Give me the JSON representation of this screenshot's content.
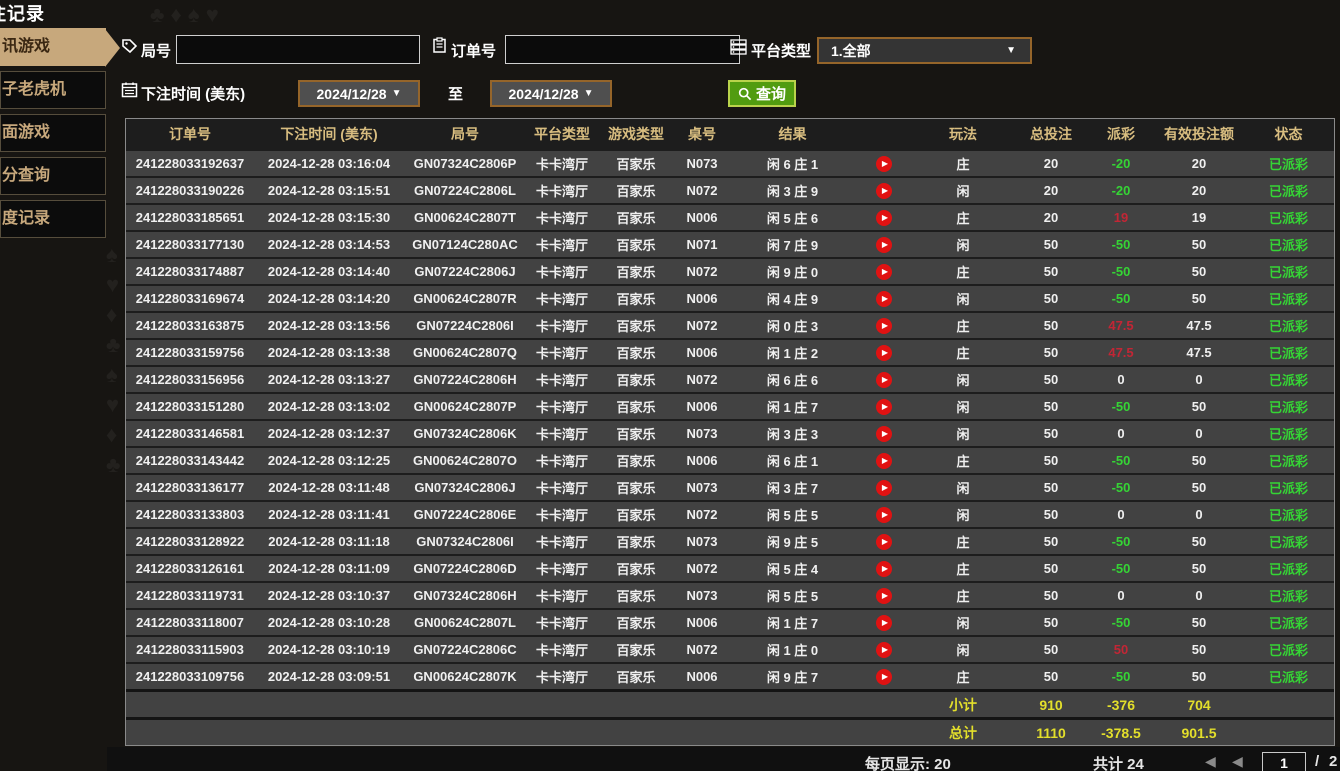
{
  "colors": {
    "page_bg": "#171512",
    "tan": "#c7a87c",
    "gold": "#d8bd80",
    "green": "#35d435",
    "red": "#e01212",
    "red_txt": "#c22635",
    "yellow": "#e3df2b",
    "btn_green": "#519c10",
    "sel_border": "#95652a",
    "row_bg": "#424242"
  },
  "title": "注记录",
  "sidebar": {
    "items": [
      {
        "label": "讯游戏",
        "selected": true
      },
      {
        "label": "子老虎机",
        "selected": false
      },
      {
        "label": "面游戏",
        "selected": false
      },
      {
        "label": "分查询",
        "selected": false
      },
      {
        "label": "度记录",
        "selected": false
      }
    ]
  },
  "filters": {
    "round_label": "局号",
    "round_value": "",
    "order_label": "订单号",
    "order_value": "",
    "platform_label": "平台类型",
    "platform_value": "1.全部",
    "bettime_label": "下注时间 (美东)",
    "date_from": "2024/12/28",
    "to_label": "至",
    "date_to": "2024/12/28",
    "search_label": "查询",
    "caret": "▼"
  },
  "table": {
    "headers": [
      "订单号",
      "下注时间 (美东)",
      "局号",
      "平台类型",
      "游戏类型",
      "桌号",
      "结果",
      "玩法",
      "总投注",
      "派彩",
      "有效投注额",
      "状态"
    ],
    "rows": [
      {
        "order_id": "241228033192637",
        "bet_time": "2024-12-28 03:16:04",
        "round_id": "GN07324C2806P",
        "platform": "卡卡湾厅",
        "game_type": "百家乐",
        "table_no": "N073",
        "result": "闲 6 庄 1",
        "bet_on": "庄",
        "total_bet": "20",
        "payout": "-20",
        "valid_bet": "20",
        "status": "已派彩"
      },
      {
        "order_id": "241228033190226",
        "bet_time": "2024-12-28 03:15:51",
        "round_id": "GN07224C2806L",
        "platform": "卡卡湾厅",
        "game_type": "百家乐",
        "table_no": "N072",
        "result": "闲 3 庄 9",
        "bet_on": "闲",
        "total_bet": "20",
        "payout": "-20",
        "valid_bet": "20",
        "status": "已派彩"
      },
      {
        "order_id": "241228033185651",
        "bet_time": "2024-12-28 03:15:30",
        "round_id": "GN00624C2807T",
        "platform": "卡卡湾厅",
        "game_type": "百家乐",
        "table_no": "N006",
        "result": "闲 5 庄 6",
        "bet_on": "庄",
        "total_bet": "20",
        "payout": "19",
        "valid_bet": "19",
        "status": "已派彩"
      },
      {
        "order_id": "241228033177130",
        "bet_time": "2024-12-28 03:14:53",
        "round_id": "GN07124C280AC",
        "platform": "卡卡湾厅",
        "game_type": "百家乐",
        "table_no": "N071",
        "result": "闲 7 庄 9",
        "bet_on": "闲",
        "total_bet": "50",
        "payout": "-50",
        "valid_bet": "50",
        "status": "已派彩"
      },
      {
        "order_id": "241228033174887",
        "bet_time": "2024-12-28 03:14:40",
        "round_id": "GN07224C2806J",
        "platform": "卡卡湾厅",
        "game_type": "百家乐",
        "table_no": "N072",
        "result": "闲 9 庄 0",
        "bet_on": "庄",
        "total_bet": "50",
        "payout": "-50",
        "valid_bet": "50",
        "status": "已派彩"
      },
      {
        "order_id": "241228033169674",
        "bet_time": "2024-12-28 03:14:20",
        "round_id": "GN00624C2807R",
        "platform": "卡卡湾厅",
        "game_type": "百家乐",
        "table_no": "N006",
        "result": "闲 4 庄 9",
        "bet_on": "闲",
        "total_bet": "50",
        "payout": "-50",
        "valid_bet": "50",
        "status": "已派彩"
      },
      {
        "order_id": "241228033163875",
        "bet_time": "2024-12-28 03:13:56",
        "round_id": "GN07224C2806I",
        "platform": "卡卡湾厅",
        "game_type": "百家乐",
        "table_no": "N072",
        "result": "闲 0 庄 3",
        "bet_on": "庄",
        "total_bet": "50",
        "payout": "47.5",
        "valid_bet": "47.5",
        "status": "已派彩"
      },
      {
        "order_id": "241228033159756",
        "bet_time": "2024-12-28 03:13:38",
        "round_id": "GN00624C2807Q",
        "platform": "卡卡湾厅",
        "game_type": "百家乐",
        "table_no": "N006",
        "result": "闲 1 庄 2",
        "bet_on": "庄",
        "total_bet": "50",
        "payout": "47.5",
        "valid_bet": "47.5",
        "status": "已派彩"
      },
      {
        "order_id": "241228033156956",
        "bet_time": "2024-12-28 03:13:27",
        "round_id": "GN07224C2806H",
        "platform": "卡卡湾厅",
        "game_type": "百家乐",
        "table_no": "N072",
        "result": "闲 6 庄 6",
        "bet_on": "闲",
        "total_bet": "50",
        "payout": "0",
        "valid_bet": "0",
        "status": "已派彩"
      },
      {
        "order_id": "241228033151280",
        "bet_time": "2024-12-28 03:13:02",
        "round_id": "GN00624C2807P",
        "platform": "卡卡湾厅",
        "game_type": "百家乐",
        "table_no": "N006",
        "result": "闲 1 庄 7",
        "bet_on": "闲",
        "total_bet": "50",
        "payout": "-50",
        "valid_bet": "50",
        "status": "已派彩"
      },
      {
        "order_id": "241228033146581",
        "bet_time": "2024-12-28 03:12:37",
        "round_id": "GN07324C2806K",
        "platform": "卡卡湾厅",
        "game_type": "百家乐",
        "table_no": "N073",
        "result": "闲 3 庄 3",
        "bet_on": "闲",
        "total_bet": "50",
        "payout": "0",
        "valid_bet": "0",
        "status": "已派彩"
      },
      {
        "order_id": "241228033143442",
        "bet_time": "2024-12-28 03:12:25",
        "round_id": "GN00624C2807O",
        "platform": "卡卡湾厅",
        "game_type": "百家乐",
        "table_no": "N006",
        "result": "闲 6 庄 1",
        "bet_on": "庄",
        "total_bet": "50",
        "payout": "-50",
        "valid_bet": "50",
        "status": "已派彩"
      },
      {
        "order_id": "241228033136177",
        "bet_time": "2024-12-28 03:11:48",
        "round_id": "GN07324C2806J",
        "platform": "卡卡湾厅",
        "game_type": "百家乐",
        "table_no": "N073",
        "result": "闲 3 庄 7",
        "bet_on": "闲",
        "total_bet": "50",
        "payout": "-50",
        "valid_bet": "50",
        "status": "已派彩"
      },
      {
        "order_id": "241228033133803",
        "bet_time": "2024-12-28 03:11:41",
        "round_id": "GN07224C2806E",
        "platform": "卡卡湾厅",
        "game_type": "百家乐",
        "table_no": "N072",
        "result": "闲 5 庄 5",
        "bet_on": "闲",
        "total_bet": "50",
        "payout": "0",
        "valid_bet": "0",
        "status": "已派彩"
      },
      {
        "order_id": "241228033128922",
        "bet_time": "2024-12-28 03:11:18",
        "round_id": "GN07324C2806I",
        "platform": "卡卡湾厅",
        "game_type": "百家乐",
        "table_no": "N073",
        "result": "闲 9 庄 5",
        "bet_on": "庄",
        "total_bet": "50",
        "payout": "-50",
        "valid_bet": "50",
        "status": "已派彩"
      },
      {
        "order_id": "241228033126161",
        "bet_time": "2024-12-28 03:11:09",
        "round_id": "GN07224C2806D",
        "platform": "卡卡湾厅",
        "game_type": "百家乐",
        "table_no": "N072",
        "result": "闲 5 庄 4",
        "bet_on": "庄",
        "total_bet": "50",
        "payout": "-50",
        "valid_bet": "50",
        "status": "已派彩"
      },
      {
        "order_id": "241228033119731",
        "bet_time": "2024-12-28 03:10:37",
        "round_id": "GN07324C2806H",
        "platform": "卡卡湾厅",
        "game_type": "百家乐",
        "table_no": "N073",
        "result": "闲 5 庄 5",
        "bet_on": "庄",
        "total_bet": "50",
        "payout": "0",
        "valid_bet": "0",
        "status": "已派彩"
      },
      {
        "order_id": "241228033118007",
        "bet_time": "2024-12-28 03:10:28",
        "round_id": "GN00624C2807L",
        "platform": "卡卡湾厅",
        "game_type": "百家乐",
        "table_no": "N006",
        "result": "闲 1 庄 7",
        "bet_on": "闲",
        "total_bet": "50",
        "payout": "-50",
        "valid_bet": "50",
        "status": "已派彩"
      },
      {
        "order_id": "241228033115903",
        "bet_time": "2024-12-28 03:10:19",
        "round_id": "GN07224C2806C",
        "platform": "卡卡湾厅",
        "game_type": "百家乐",
        "table_no": "N072",
        "result": "闲 1 庄 0",
        "bet_on": "闲",
        "total_bet": "50",
        "payout": "50",
        "valid_bet": "50",
        "status": "已派彩"
      },
      {
        "order_id": "241228033109756",
        "bet_time": "2024-12-28 03:09:51",
        "round_id": "GN00624C2807K",
        "platform": "卡卡湾厅",
        "game_type": "百家乐",
        "table_no": "N006",
        "result": "闲 9 庄 7",
        "bet_on": "庄",
        "total_bet": "50",
        "payout": "-50",
        "valid_bet": "50",
        "status": "已派彩"
      }
    ],
    "subtotal": {
      "label": "小计",
      "total_bet": "910",
      "payout": "-376",
      "valid_bet": "704"
    },
    "grandtotal": {
      "label": "总计",
      "total_bet": "1110",
      "payout": "-378.5",
      "valid_bet": "901.5"
    }
  },
  "footer": {
    "per_page_label": "每页显示: 20",
    "total_count_label": "共计 24",
    "prev_arrow": "◀",
    "first_arrow": "◀",
    "page_current": "1",
    "page_separator": "/",
    "page_total": "2"
  }
}
